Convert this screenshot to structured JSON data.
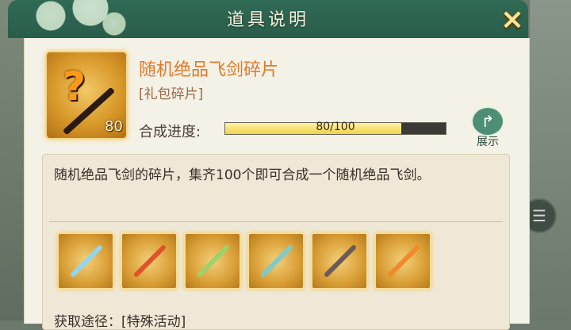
{
  "dialog": {
    "title": "道具说明",
    "close_icon": "×"
  },
  "item": {
    "name": "随机绝品飞剑碎片",
    "type": "[礼包碎片]",
    "count": "80",
    "icon": "question-mark-sword-icon"
  },
  "progress": {
    "label": "合成进度:",
    "text": "80/100",
    "current": 80,
    "max": 100
  },
  "share": {
    "label": "展示",
    "icon": "share-arrow-icon"
  },
  "description": "随机绝品飞剑的碎片，集齐100个即可合成一个随机绝品飞剑。",
  "swords": [
    {
      "icon": "ice-sword-icon",
      "color": "#8fd6f0"
    },
    {
      "icon": "fire-sword-icon",
      "color": "#e0532a"
    },
    {
      "icon": "jade-sword-icon",
      "color": "#9fd16a"
    },
    {
      "icon": "crystal-sword-icon",
      "color": "#7fcac8"
    },
    {
      "icon": "dark-sword-icon",
      "color": "#6b5a5a"
    },
    {
      "icon": "flame-sword-icon",
      "color": "#f08a2a"
    }
  ],
  "obtain": "获取途径：[特殊活动]"
}
